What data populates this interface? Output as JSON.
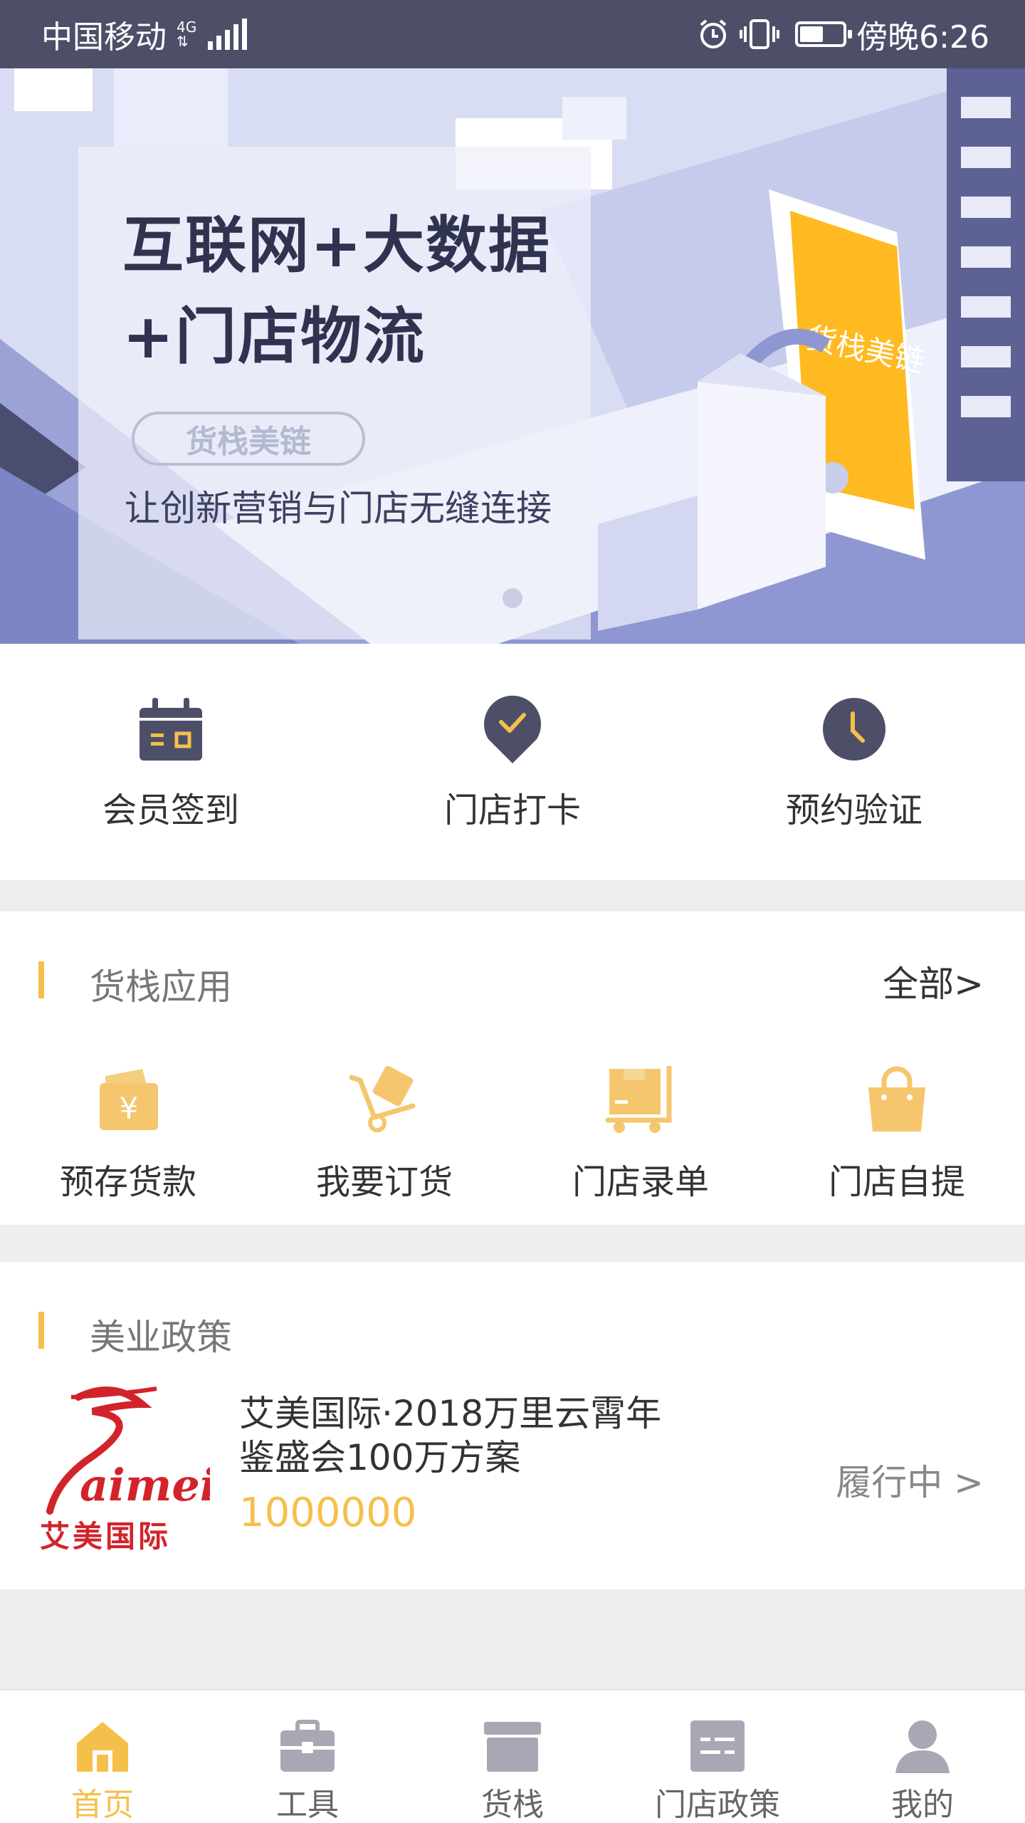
{
  "status_bar": {
    "carrier": "中国移动",
    "network": "4G",
    "time": "傍晚6:26",
    "battery_level": 0.55
  },
  "banner": {
    "headline_line1": "互联网+大数据",
    "headline_line2": "+门店物流",
    "tag": "货栈美链",
    "subtitle": "让创新营销与门店无缝连接",
    "phone_brand": "货栈美链",
    "page_index": 1,
    "page_count": 1
  },
  "quick_actions": [
    {
      "label": "会员签到",
      "icon": "calendar-icon"
    },
    {
      "label": "门店打卡",
      "icon": "location-check-icon"
    },
    {
      "label": "预约验证",
      "icon": "clock-icon"
    }
  ],
  "apps_section": {
    "title": "货栈应用",
    "more": "全部>",
    "items": [
      {
        "label": "预存货款",
        "icon": "wallet-yen-icon"
      },
      {
        "label": "我要订货",
        "icon": "hand-truck-icon"
      },
      {
        "label": "门店录单",
        "icon": "delivery-cart-icon"
      },
      {
        "label": "门店自提",
        "icon": "shopping-bag-icon"
      }
    ]
  },
  "policy_section": {
    "title": "美业政策",
    "items": [
      {
        "logo_text": "aimei",
        "logo_sub": "艾美国际",
        "title": "艾美国际·2018万里云霄年鉴盛会100万方案",
        "amount": "1000000",
        "status": "履行中 >"
      }
    ]
  },
  "bottom_nav": {
    "items": [
      {
        "label": "首页",
        "icon": "home-icon",
        "active": true
      },
      {
        "label": "工具",
        "icon": "toolbox-icon",
        "active": false
      },
      {
        "label": "货栈",
        "icon": "archive-box-icon",
        "active": false
      },
      {
        "label": "门店政策",
        "icon": "policy-card-icon",
        "active": false
      },
      {
        "label": "我的",
        "icon": "user-icon",
        "active": false
      }
    ]
  },
  "colors": {
    "status_bar_bg": "#4d4f69",
    "accent_yellow": "#f5c04a",
    "icon_dark": "#4d4f69",
    "icon_light_yellow": "#f5cf80",
    "nav_inactive": "#a7a8b3"
  }
}
